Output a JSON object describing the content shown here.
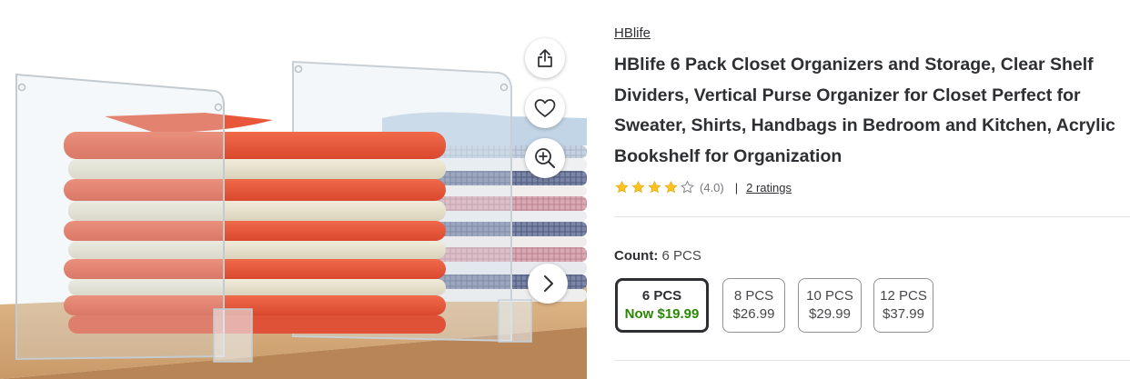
{
  "product": {
    "brand": "HBlife",
    "title": "HBlife 6 Pack Closet Organizers and Storage, Clear Shelf Dividers, Vertical Purse Organizer for Closet Perfect for Sweater, Shirts, Handbags in Bedroom and Kitchen, Acrylic Bookshelf for Organization",
    "rating": {
      "stars": 4,
      "max_stars": 5,
      "value_text": "(4.0)",
      "separator": "|",
      "count_text": "2 ratings"
    },
    "count": {
      "label": "Count:",
      "selected": "6 PCS"
    },
    "variants": [
      {
        "name": "6 PCS",
        "price": "Now $19.99",
        "selected": true
      },
      {
        "name": "8 PCS",
        "price": "$26.99",
        "selected": false
      },
      {
        "name": "10 PCS",
        "price": "$29.99",
        "selected": false
      },
      {
        "name": "12 PCS",
        "price": "$37.99",
        "selected": false
      }
    ]
  },
  "media": {
    "image": "clear acrylic shelf dividers holding folded orange, cream and plaid shirts on a wooden shelf",
    "icons": [
      "share-icon",
      "heart-icon",
      "zoom-in-icon",
      "chevron-right-icon"
    ]
  },
  "colors": {
    "text": "#2e2f32",
    "muted": "#74767c",
    "price_green": "#2a8703",
    "star": "#ffc220",
    "divider": "#e3e4e5"
  }
}
